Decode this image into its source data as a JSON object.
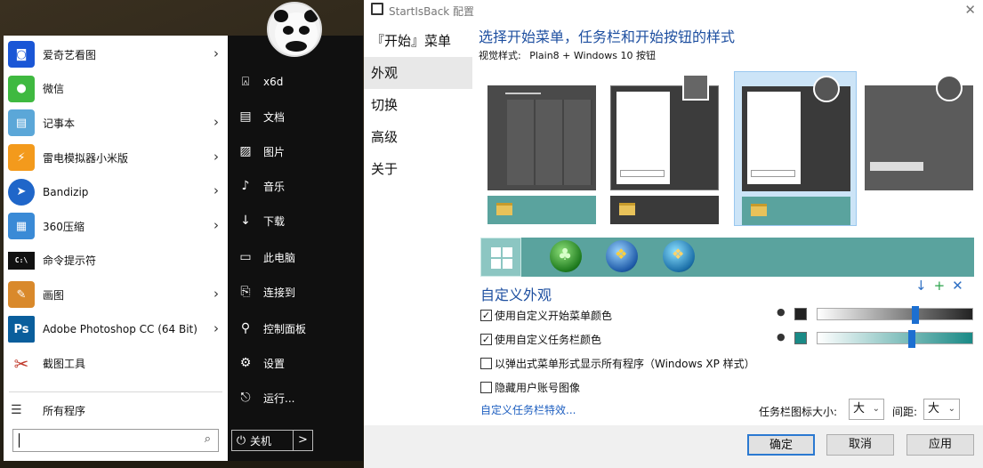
{
  "start_menu": {
    "apps": [
      {
        "label": "爱奇艺看图",
        "icon": "iqiyi-photo-icon",
        "color": "#1a56d6",
        "glyph": "◙",
        "arrow": true
      },
      {
        "label": "微信",
        "icon": "wechat-icon",
        "color": "#3fb940",
        "glyph": "●",
        "arrow": false
      },
      {
        "label": "记事本",
        "icon": "notepad-icon",
        "color": "#5ba7d8",
        "glyph": "▤",
        "arrow": true
      },
      {
        "label": "雷电模拟器小米版",
        "icon": "ldplayer-icon",
        "color": "#f39a1c",
        "glyph": "⚡",
        "arrow": true
      },
      {
        "label": "Bandizip",
        "icon": "bandizip-icon",
        "color": "#1f66c9",
        "glyph": "➤",
        "arrow": true
      },
      {
        "label": "360压缩",
        "icon": "360zip-icon",
        "color": "#3a8ad6",
        "glyph": "▦",
        "arrow": true
      },
      {
        "label": "命令提示符",
        "icon": "cmd-icon",
        "color": "#111111",
        "glyph": "C:\\",
        "arrow": false
      },
      {
        "label": "画图",
        "icon": "paint-icon",
        "color": "#d9892b",
        "glyph": "✎",
        "arrow": true
      },
      {
        "label": "Adobe Photoshop CC (64 Bit)",
        "icon": "photoshop-icon",
        "color": "#0a5e9c",
        "glyph": "Ps",
        "arrow": true
      },
      {
        "label": "截图工具",
        "icon": "snipping-tool-icon",
        "color": "#c0392b",
        "glyph": "✂",
        "arrow": false
      }
    ],
    "all_programs": "所有程序",
    "search_placeholder": "",
    "right_items": [
      {
        "label": "x6d",
        "icon": "user-folder-icon",
        "glyph": "⍓"
      },
      {
        "label": "文档",
        "icon": "document-icon",
        "glyph": "▤"
      },
      {
        "label": "图片",
        "icon": "pictures-icon",
        "glyph": "▨"
      },
      {
        "label": "音乐",
        "icon": "music-icon",
        "glyph": "♪"
      },
      {
        "label": "下载",
        "icon": "download-icon",
        "glyph": "↓"
      },
      {
        "label": "此电脑",
        "icon": "computer-icon",
        "glyph": "▭"
      },
      {
        "label": "连接到",
        "icon": "connect-icon",
        "glyph": "⎘"
      },
      {
        "label": "控制面板",
        "icon": "control-panel-icon",
        "glyph": "⚙"
      },
      {
        "label": "设置",
        "icon": "settings-icon",
        "glyph": "⚙"
      },
      {
        "label": "运行...",
        "icon": "run-icon",
        "glyph": "⎋"
      }
    ],
    "power_label": "关机",
    "power_arrow": ">"
  },
  "dialog": {
    "title": "StartIsBack 配置",
    "nav": [
      "『开始』菜单",
      "外观",
      "切换",
      "高级",
      "关于"
    ],
    "active_nav": 1,
    "heading": "选择开始菜单，任务栏和开始按钮的样式",
    "visual_style_label": "视觉样式:",
    "visual_style_value": "Plain8 + Windows 10 按钮",
    "custom_heading": "自定义外观",
    "checkboxes": [
      {
        "label": "使用自定义开始菜单颜色",
        "checked": true
      },
      {
        "label": "使用自定义任务栏颜色",
        "checked": true
      },
      {
        "label": "以弹出式菜单形式显示所有程序（Windows XP 样式）",
        "checked": false
      },
      {
        "label": "隐藏用户账号图像",
        "checked": false
      }
    ],
    "start_color": "#222222",
    "taskbar_color": "#1a8a86",
    "start_slider_value": 0.6,
    "taskbar_slider_value": 0.58,
    "taskbar_effects_link": "自定义任务栏特效...",
    "icon_size_label": "任务栏图标大小:",
    "icon_size_value": "大",
    "spacing_label": "间距:",
    "spacing_value": "大",
    "buttons": {
      "ok": "确定",
      "cancel": "取消",
      "apply": "应用"
    },
    "custom_actions": [
      "↓",
      "+",
      "✕"
    ]
  }
}
